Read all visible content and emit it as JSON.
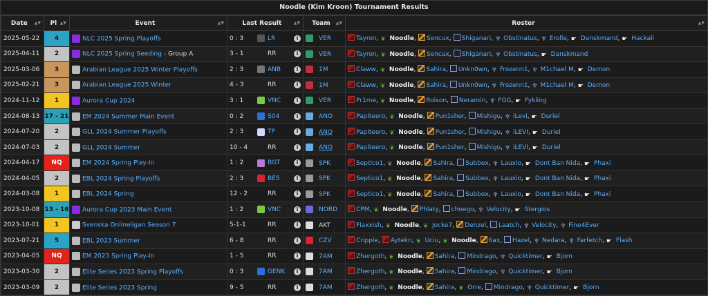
{
  "title": "Noodle (Kim Kroon) Tournament Results",
  "headers": {
    "date": "Date",
    "pl": "Pl",
    "event": "Event",
    "last_result": "Last Result",
    "team": "Team",
    "roster": "Roster"
  },
  "info_glyph": "i",
  "colors": {
    "link": "#5ab0ff",
    "gold": "#f2c522",
    "silver": "#c3c3c3",
    "bronze": "#c8955c",
    "blue": "#2aa3c7",
    "nq": "#e3221c"
  },
  "rows": [
    {
      "date": "2025-05-22",
      "pl": "4",
      "plc": "pl-blue",
      "icon": "#8a2be2",
      "event": "NLC 2025 Spring Playoffs",
      "sub": "",
      "score": "0 : 3",
      "oppicon": "#555",
      "opp": "LR",
      "opp_plain": false,
      "tcol": "#2e9c6a",
      "team": "VER",
      "tund": false,
      "roster": [
        [
          "top",
          "Tayron"
        ],
        [
          "jg",
          "Noodle",
          1
        ],
        [
          "mid",
          "Sencux"
        ],
        [
          "adc",
          "Shiganari"
        ],
        [
          "sup",
          "Obstinatus"
        ],
        [
          "sup",
          "Erolle"
        ],
        [
          "sub",
          "Danskmand"
        ],
        [
          "sub",
          "Hackali"
        ]
      ]
    },
    {
      "date": "2025-04-11",
      "pl": "2",
      "plc": "pl-silver",
      "icon": "#8a2be2",
      "event": "NLC 2025 Spring Seeding",
      "sub": " - Group A",
      "score": "3 - 1",
      "oppicon": "",
      "opp": "RR",
      "opp_plain": true,
      "tcol": "#2e9c6a",
      "team": "VER",
      "tund": false,
      "roster": [
        [
          "top",
          "Tayron"
        ],
        [
          "jg",
          "Noodle",
          1
        ],
        [
          "mid",
          "Sencux"
        ],
        [
          "adc",
          "Shiganari"
        ],
        [
          "sup",
          "Obstinatus"
        ],
        [
          "sub",
          "Danskmand"
        ]
      ]
    },
    {
      "date": "2025-03-06",
      "pl": "3",
      "plc": "pl-bronze",
      "icon": "#bbb",
      "event": "Arabian League 2025 Winter Playoffs",
      "sub": "",
      "score": "2 : 3",
      "oppicon": "#777",
      "opp": "ANB",
      "opp_plain": false,
      "tcol": "#c0303a",
      "team": "1M",
      "tund": false,
      "roster": [
        [
          "top",
          "Claww"
        ],
        [
          "jg",
          "Noodle",
          1
        ],
        [
          "mid",
          "Sahira"
        ],
        [
          "adc",
          "Unkn0wn"
        ],
        [
          "sup",
          "Frozenn1"
        ],
        [
          "sup",
          "M1chael M"
        ],
        [
          "sub",
          "Demon"
        ]
      ]
    },
    {
      "date": "2025-02-21",
      "pl": "3",
      "plc": "pl-bronze",
      "icon": "#bbb",
      "event": "Arabian League 2025 Winter",
      "sub": "",
      "score": "4 - 3",
      "oppicon": "",
      "opp": "RR",
      "opp_plain": true,
      "tcol": "#c0303a",
      "team": "1M",
      "tund": false,
      "roster": [
        [
          "top",
          "Claww"
        ],
        [
          "jg",
          "Noodle",
          1
        ],
        [
          "mid",
          "Sahira"
        ],
        [
          "adc",
          "Unkn0wn"
        ],
        [
          "sup",
          "Frozenn1"
        ],
        [
          "sup",
          "M1chael M"
        ],
        [
          "sub",
          "Demon"
        ]
      ]
    },
    {
      "date": "2024-11-12",
      "pl": "1",
      "plc": "pl-gold",
      "icon": "#8a2be2",
      "event": "Aurora Cup 2024",
      "sub": "",
      "score": "3 : 1",
      "oppicon": "#7ac943",
      "opp": "VNC",
      "opp_plain": false,
      "tcol": "#2e9c6a",
      "team": "VER",
      "tund": false,
      "roster": [
        [
          "top",
          "Pr1me"
        ],
        [
          "jg",
          "Noodle",
          1
        ],
        [
          "mid",
          "Roison"
        ],
        [
          "adc",
          "Neramin"
        ],
        [
          "sup",
          "FGG"
        ],
        [
          "sub",
          "Fykling"
        ]
      ]
    },
    {
      "date": "2024-08-13",
      "pl": "17 - 21",
      "plc": "pl-teal",
      "icon": "#bbb",
      "event": "EM 2024 Summer Main Event",
      "sub": "",
      "score": "0 : 2",
      "oppicon": "#2d6fd6",
      "opp": "S04",
      "opp_plain": false,
      "tcol": "#6aa8e0",
      "team": "ANO",
      "tund": false,
      "roster": [
        [
          "top",
          "Papiteero"
        ],
        [
          "jg",
          "Noodle",
          1
        ],
        [
          "mid",
          "Pun1sher"
        ],
        [
          "adc",
          "Mishigu"
        ],
        [
          "sup",
          "iLevi"
        ],
        [
          "sub",
          "Duriel"
        ]
      ]
    },
    {
      "date": "2024-07-20",
      "pl": "2",
      "plc": "pl-silver",
      "icon": "#bbb",
      "event": "GLL 2024 Summer Playoffs",
      "sub": "",
      "score": "2 : 3",
      "oppicon": "#cfd8ff",
      "opp": "TP",
      "opp_plain": false,
      "tcol": "#6aa8e0",
      "team": "ANO",
      "tund": true,
      "roster": [
        [
          "top",
          "Papiteero"
        ],
        [
          "jg",
          "Noodle",
          1
        ],
        [
          "mid",
          "Pun1sher"
        ],
        [
          "adc",
          "Mishigu"
        ],
        [
          "sup",
          "iLEVI"
        ],
        [
          "sub",
          "Duriel"
        ]
      ]
    },
    {
      "date": "2024-07-03",
      "pl": "2",
      "plc": "pl-silver",
      "icon": "#bbb",
      "event": "GLL 2024 Summer",
      "sub": "",
      "score": "10 - 4",
      "oppicon": "",
      "opp": "RR",
      "opp_plain": true,
      "tcol": "#6aa8e0",
      "team": "ANO",
      "tund": true,
      "roster": [
        [
          "top",
          "Papiteero"
        ],
        [
          "jg",
          "Noodle",
          1
        ],
        [
          "mid",
          "Pun1sher"
        ],
        [
          "adc",
          "Mishigu"
        ],
        [
          "sup",
          "iLEVI"
        ],
        [
          "sub",
          "Duriel"
        ]
      ]
    },
    {
      "date": "2024-04-17",
      "pl": "NQ",
      "plc": "pl-nq",
      "icon": "#bbb",
      "event": "EM 2024 Spring Play-In",
      "sub": "",
      "score": "1 : 2",
      "oppicon": "#b67ad8",
      "opp": "BGT",
      "opp_plain": false,
      "tcol": "#999",
      "team": "SPK",
      "tund": false,
      "roster": [
        [
          "top",
          "Septico1"
        ],
        [
          "jg",
          "Noodle",
          1
        ],
        [
          "mid",
          "Sahira"
        ],
        [
          "adc",
          "Subbex"
        ],
        [
          "sup",
          "Lauxio"
        ],
        [
          "sub",
          "Dont Ban Nida"
        ],
        [
          "sub",
          "Phaxi"
        ]
      ]
    },
    {
      "date": "2024-04-05",
      "pl": "2",
      "plc": "pl-silver",
      "icon": "#bbb",
      "event": "EBL 2024 Spring Playoffs",
      "sub": "",
      "score": "2 : 3",
      "oppicon": "#d23",
      "opp": "BE5",
      "opp_plain": false,
      "tcol": "#999",
      "team": "SPK",
      "tund": false,
      "roster": [
        [
          "top",
          "Septico1"
        ],
        [
          "jg",
          "Noodle",
          1
        ],
        [
          "mid",
          "Sahira"
        ],
        [
          "adc",
          "Subbex"
        ],
        [
          "sup",
          "Lauxio"
        ],
        [
          "sub",
          "Dont Ban Nida"
        ],
        [
          "sub",
          "Phaxi"
        ]
      ]
    },
    {
      "date": "2024-03-08",
      "pl": "1",
      "plc": "pl-gold",
      "icon": "#bbb",
      "event": "EBL 2024 Spring",
      "sub": "",
      "score": "12 - 2",
      "oppicon": "",
      "opp": "RR",
      "opp_plain": true,
      "tcol": "#999",
      "team": "SPK",
      "tund": false,
      "roster": [
        [
          "top",
          "Septico1"
        ],
        [
          "jg",
          "Noodle",
          1
        ],
        [
          "mid",
          "Sahira"
        ],
        [
          "adc",
          "Subbex"
        ],
        [
          "sup",
          "Lauxio"
        ],
        [
          "sub",
          "Dont Ban Nida"
        ],
        [
          "sub",
          "Phaxi"
        ]
      ]
    },
    {
      "date": "2023-10-08",
      "pl": "13 - 16",
      "plc": "pl-teal",
      "icon": "#8a2be2",
      "event": "Aurora Cup 2023 Main Event",
      "sub": "",
      "score": "1 : 2",
      "oppicon": "#7ac943",
      "opp": "VNC",
      "opp_plain": false,
      "tcol": "#6a6ad8",
      "team": "NORD",
      "tund": false,
      "roster": [
        [
          "top",
          "CPM"
        ],
        [
          "jg",
          "Noodle",
          1
        ],
        [
          "mid",
          "Phlaty"
        ],
        [
          "adc",
          "choego"
        ],
        [
          "sup",
          "Velocity"
        ],
        [
          "sub",
          "Stergios"
        ]
      ]
    },
    {
      "date": "2023-10-01",
      "pl": "1",
      "plc": "pl-gold",
      "icon": "#ccc",
      "event": "Svenska Onlineligan Season 7",
      "sub": "",
      "score": "5-1-1",
      "oppicon": "",
      "opp": "RR",
      "opp_plain": true,
      "tcol": "#ddd",
      "team": "AKT",
      "tund": false,
      "tplain": true,
      "roster": [
        [
          "top",
          "Flaxxish"
        ],
        [
          "jg",
          "Noodle",
          1
        ],
        [
          "jg",
          "Jocke7"
        ],
        [
          "mid",
          "Denzel"
        ],
        [
          "adc",
          "Laatch"
        ],
        [
          "sup",
          "Velocity"
        ],
        [
          "sup",
          "Fine4Ever"
        ]
      ]
    },
    {
      "date": "2023-07-21",
      "pl": "5",
      "plc": "pl-blue",
      "icon": "#bbb",
      "event": "EBL 2023 Summer",
      "sub": "",
      "score": "6 - 8",
      "oppicon": "",
      "opp": "RR",
      "opp_plain": true,
      "tcol": "#d23",
      "team": "CZV",
      "tund": false,
      "roster": [
        [
          "top",
          "Cripple"
        ],
        [
          "top",
          "Aytekn"
        ],
        [
          "jg",
          "Uciu"
        ],
        [
          "jg",
          "Noodle",
          1
        ],
        [
          "mid",
          "6ax"
        ],
        [
          "adc",
          "Hazel"
        ],
        [
          "sup",
          "Nedara"
        ],
        [
          "sup",
          "Farfetch"
        ],
        [
          "sub",
          "Flash"
        ]
      ]
    },
    {
      "date": "2023-04-05",
      "pl": "NQ",
      "plc": "pl-nq",
      "icon": "#bbb",
      "event": "EM 2023 Spring Play-In",
      "sub": "",
      "score": "1 - 5",
      "oppicon": "",
      "opp": "RR",
      "opp_plain": true,
      "tcol": "#ddd",
      "team": "7AM",
      "tund": false,
      "roster": [
        [
          "top",
          "Zhergoth"
        ],
        [
          "jg",
          "Noodle",
          1
        ],
        [
          "mid",
          "Sahira"
        ],
        [
          "adc",
          "Mindrago"
        ],
        [
          "sup",
          "Quicktimer"
        ],
        [
          "sub",
          "Bjorn"
        ]
      ]
    },
    {
      "date": "2023-03-30",
      "pl": "2",
      "plc": "pl-silver",
      "icon": "#bbb",
      "event": "Elite Series 2023 Spring Playoffs",
      "sub": "",
      "score": "0 : 3",
      "oppicon": "#2d6fd6",
      "opp": "GENK",
      "opp_plain": false,
      "tcol": "#ddd",
      "team": "7AM",
      "tund": false,
      "roster": [
        [
          "top",
          "Zhergoth"
        ],
        [
          "jg",
          "Noodle",
          1
        ],
        [
          "mid",
          "Sahira"
        ],
        [
          "adc",
          "Mindrago"
        ],
        [
          "sup",
          "Quicktimer"
        ],
        [
          "sub",
          "Bjorn"
        ]
      ]
    },
    {
      "date": "2023-03-09",
      "pl": "2",
      "plc": "pl-silver",
      "icon": "#bbb",
      "event": "Elite Series 2023 Spring",
      "sub": "",
      "score": "9 - 5",
      "oppicon": "",
      "opp": "RR",
      "opp_plain": true,
      "tcol": "#ddd",
      "team": "7AM",
      "tund": false,
      "roster": [
        [
          "top",
          "Zhergoth"
        ],
        [
          "jg",
          "Noodle",
          1
        ],
        [
          "mid",
          "Sahira"
        ],
        [
          "jg",
          "Orre"
        ],
        [
          "adc",
          "Mindrago"
        ],
        [
          "sup",
          "Quicktimer"
        ],
        [
          "sub",
          "Bjorn"
        ]
      ]
    }
  ]
}
